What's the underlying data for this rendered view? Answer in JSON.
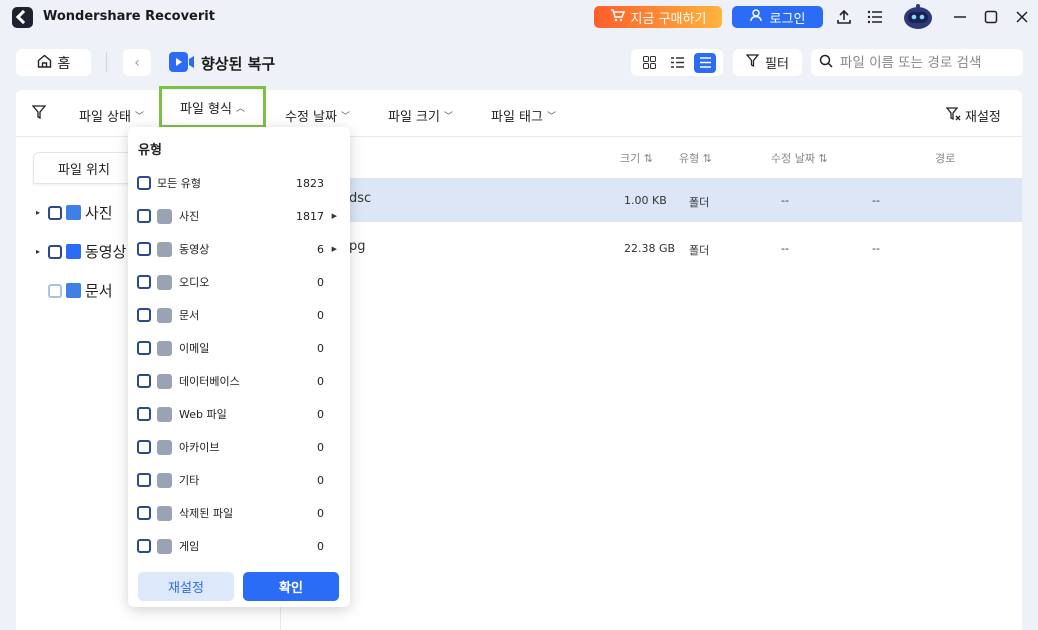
{
  "app": {
    "title": "Wondershare Recoverit",
    "buy_label": "지금 구매하기",
    "login_label": "로그인"
  },
  "toolbar": {
    "home_label": "홈",
    "page_title": "향상된 복구",
    "filter_label": "필터",
    "search_placeholder": "파일 이름 또는 경로 검색"
  },
  "filters": {
    "items": [
      "파일 상태",
      "파일 형식",
      "수정 날짜",
      "파일 크기",
      "파일 태그"
    ],
    "reset_label": "재설정"
  },
  "left": {
    "location_tab": "파일 위치",
    "tree": [
      "사진",
      "동영상",
      "문서"
    ]
  },
  "columns": {
    "size": "크기",
    "type": "유형",
    "modified": "수정 날짜",
    "path": "경로"
  },
  "rows": [
    {
      "name": "dsc",
      "size": "1.00 KB",
      "type": "폴더",
      "modified": "--",
      "path": "--"
    },
    {
      "name": "pg",
      "size": "22.38 GB",
      "type": "폴더",
      "modified": "--",
      "path": "--"
    }
  ],
  "dropdown": {
    "title": "유형",
    "items": [
      {
        "label": "모든 유형",
        "count": "1823"
      },
      {
        "label": "사진",
        "count": "1817"
      },
      {
        "label": "동영상",
        "count": "6"
      },
      {
        "label": "오디오",
        "count": "0"
      },
      {
        "label": "문서",
        "count": "0"
      },
      {
        "label": "이메일",
        "count": "0"
      },
      {
        "label": "데이터베이스",
        "count": "0"
      },
      {
        "label": "Web 파일",
        "count": "0"
      },
      {
        "label": "아카이브",
        "count": "0"
      },
      {
        "label": "기타",
        "count": "0"
      },
      {
        "label": "삭제된 파일",
        "count": "0"
      },
      {
        "label": "게임",
        "count": "0"
      }
    ],
    "reset_label": "재설정",
    "confirm_label": "확인"
  },
  "colors": {
    "accent": "#2b6cf6",
    "highlight": "#7cc242",
    "selected_row": "#dde6f7"
  }
}
